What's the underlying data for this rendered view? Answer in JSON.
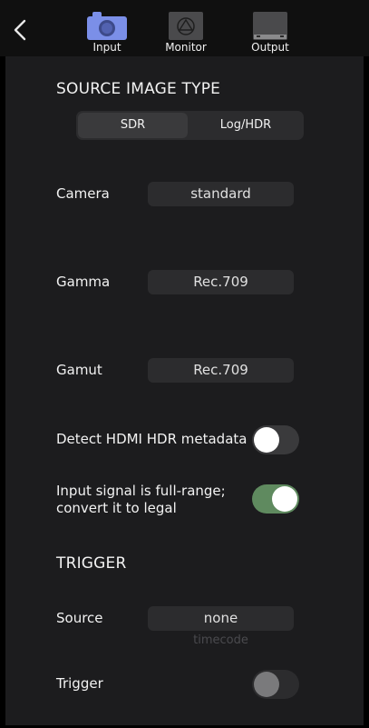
{
  "nav": {
    "tabs": [
      {
        "label": "Input",
        "icon": "camera-icon",
        "active": true
      },
      {
        "label": "Monitor",
        "icon": "atomos-monitor-icon",
        "active": false
      },
      {
        "label": "Output",
        "icon": "display-output-icon",
        "active": false
      }
    ],
    "back_icon": "chevron-left-icon"
  },
  "source_image_type": {
    "title": "SOURCE IMAGE TYPE",
    "options": [
      "SDR",
      "Log/HDR"
    ],
    "selected": "SDR"
  },
  "settings": {
    "camera": {
      "label": "Camera",
      "value": "standard"
    },
    "gamma": {
      "label": "Gamma",
      "value": "Rec.709"
    },
    "gamut": {
      "label": "Gamut",
      "value": "Rec.709"
    },
    "detect_hdmi": {
      "label": "Detect HDMI HDR metadata",
      "on": false
    },
    "full_range": {
      "label_line1": "Input signal is full-range;",
      "label_line2": "convert it to legal",
      "on": true
    }
  },
  "trigger": {
    "title": "TRIGGER",
    "source": {
      "label": "Source",
      "value": "none",
      "next_option": "timecode"
    },
    "trigger": {
      "label": "Trigger",
      "on": false,
      "enabled": false
    }
  },
  "colors": {
    "accent_active_tab": "#7b8fe8",
    "toggle_on": "#5f8a5f",
    "panel_bg": "#1c1c1e",
    "control_bg": "#2c2c2e"
  }
}
